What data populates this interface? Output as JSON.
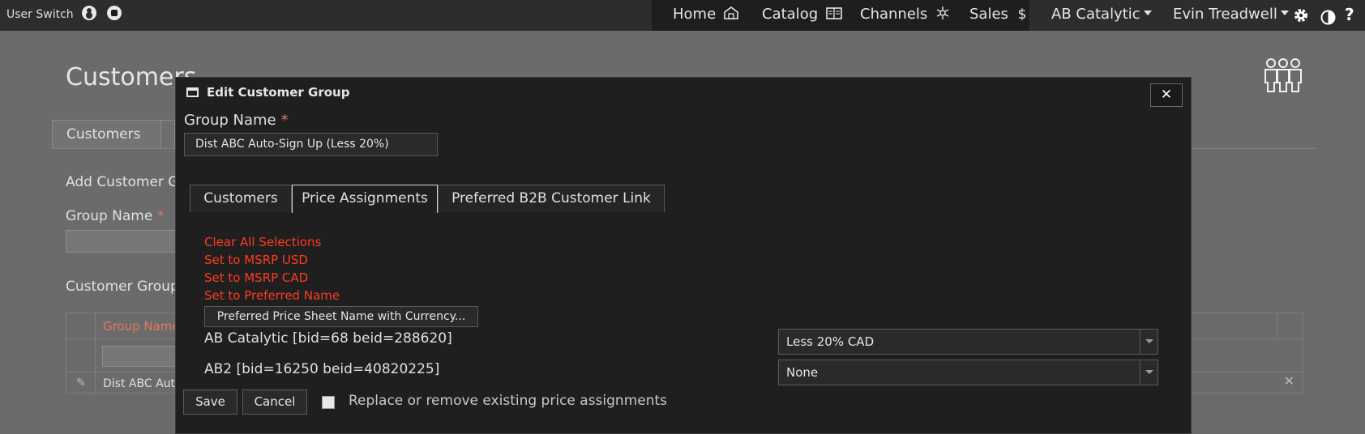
{
  "topbar": {
    "user_switch": "User Switch",
    "nav": [
      {
        "label": "Home",
        "icon": "home-icon"
      },
      {
        "label": "Catalog",
        "icon": "catalog-icon"
      },
      {
        "label": "Channels",
        "icon": "channels-icon"
      },
      {
        "label": "Sales",
        "icon": "dollar-icon"
      }
    ],
    "company": "AB Catalytic",
    "user": "Evin Treadwell"
  },
  "background": {
    "page_title": "Customers",
    "tab_label": "Customers",
    "add_group_label": "Add Customer G",
    "group_name_label": "Group Name",
    "customer_group_label": "Customer Group",
    "grid_header_group_name": "Group Name",
    "grid_row_text": "Dist ABC Aut"
  },
  "modal": {
    "title": "Edit Customer Group",
    "close_label": "✕",
    "group_name_label": "Group Name",
    "required_mark": "*",
    "group_name_value": "Dist ABC Auto-Sign Up (Less 20%)",
    "tabs": [
      "Customers",
      "Price Assignments",
      "Preferred B2B Customer Link"
    ],
    "active_tab": "Price Assignments",
    "links": [
      "Clear All Selections",
      "Set to MSRP USD",
      "Set to MSRP CAD",
      "Set to Preferred Name"
    ],
    "sheet_button": "Preferred Price Sheet Name with Currency...",
    "assignments": [
      {
        "label": "AB Catalytic [bid=68 beid=288620]",
        "value": "Less 20% CAD"
      },
      {
        "label": "AB2 [bid=16250 beid=40820225]",
        "value": "None"
      }
    ],
    "save_label": "Save",
    "cancel_label": "Cancel",
    "replace_label": "Replace or remove existing price assignments",
    "replace_checked": false
  },
  "colors": {
    "accent_link": "#ff3b1f",
    "modal_bg": "#1f1f1f",
    "overlay_bg": "#6b6b6b"
  }
}
